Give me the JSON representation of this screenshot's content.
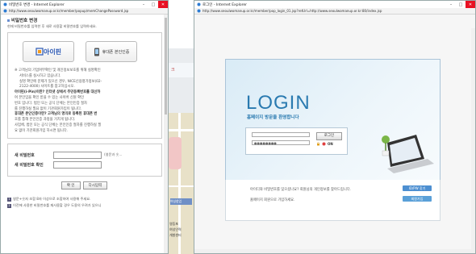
{
  "window1": {
    "title": "비밀번호 변경 - Internet Explorer",
    "url": "http://www.seoulwomanup.or.kr/member/popup/memChangePassword.jsp",
    "section_title": "비밀번호 변경",
    "section_desc": "현재 비밀번호를 입력한 후 새로 사용할 비밀번호를 입력하세요.",
    "ipin_label": "아이핀",
    "phone_label": "휴대폰 본인인증",
    "notes": [
      "※ 고객님의 기업여부확인 및 개인정보보호를 위해 실명확인",
      "서비스를 실시하고 있습니다.",
      "실명 확인에 문제가 있으신 경우, NICE신용평가정보(02-",
      "2122-4000) 사이트를 참고하십시오.",
      "아이핀(i-Pin)이란? 인터넷 상에서 주민등록번호를 대신하",
      "여 본인임을 확인 받을 수 있는 사이버 신원 확인",
      "번호 입니다. 법인 또는 공식 단체는 본인인증 절차",
      "를 진행하실 필요 없이 기관회원가입이 됩니다.",
      "휴대폰 본인인증이란? 고객님의 명의로 등록된 휴대폰 번",
      "호를 통해 본인인증 과정을 거치게 됩니다.",
      "사업체, 법인 또는 공식 단체는 본인인증 절차를 진행하실 필",
      "요 없이 기관회원가입 하시면 됩니다."
    ],
    "new_pw_label": "새 비밀번호",
    "new_pw_hint": "(영문과 숫...",
    "confirm_pw_label": "새 비밀번호 확인",
    "confirm_label": "확 인",
    "rewrite_label": "다시입력",
    "foot": [
      "영문+숫자 조합 8자 이상으로 조합하여 사용해 주세요.",
      "이전에 사용한 비밀번호를 재사용할 경우 도용의 우려가 있으니"
    ]
  },
  "background": {
    "map_labels": [
      "크",
      "여성창업",
      "여성인력개발센터",
      "영등포",
      "여성인력",
      "개발센터"
    ]
  },
  "window2": {
    "title": "로그인 - Internet Explorer",
    "url": "http://www.seoulwomanup.or.kr/member/pop_login_01.jsp?retUrl=http://www.seoulwomanup.or.kr:80/index.jsp",
    "login_title": "LOGIN",
    "welcome": "홈페이지 방문을 환영합니다",
    "id_placeholder": "",
    "pw_value": "●●●●●●●●",
    "login_button": "로그인",
    "save_label": "ON",
    "find_text": "아이디와 비밀번호를 잊으셨나요? 회원님의 개인정보를 찾아드립니다.",
    "join_text": "홈페이지 회원으로 가입하세요.",
    "find_button": "ID/PW 찾기",
    "join_button": "회원가입"
  },
  "colors": {
    "accent": "#2a7ab0",
    "find_btn": "#4d8fd1",
    "join_btn": "#5aa0d8"
  }
}
